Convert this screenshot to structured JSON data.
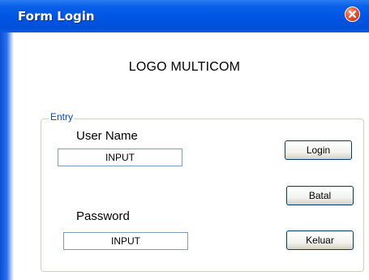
{
  "window": {
    "title": "Form Login"
  },
  "logo": {
    "text": "LOGO MULTICOM"
  },
  "entry": {
    "legend": "Entry",
    "username_label": "User Name",
    "username_value": "INPUT",
    "password_label": "Password",
    "password_value": "INPUT"
  },
  "buttons": {
    "login": "Login",
    "batal": "Batal",
    "keluar": "Keluar"
  },
  "colors": {
    "titlebar": "#0054e3",
    "legend": "#0046d5",
    "close": "#e6532f"
  }
}
